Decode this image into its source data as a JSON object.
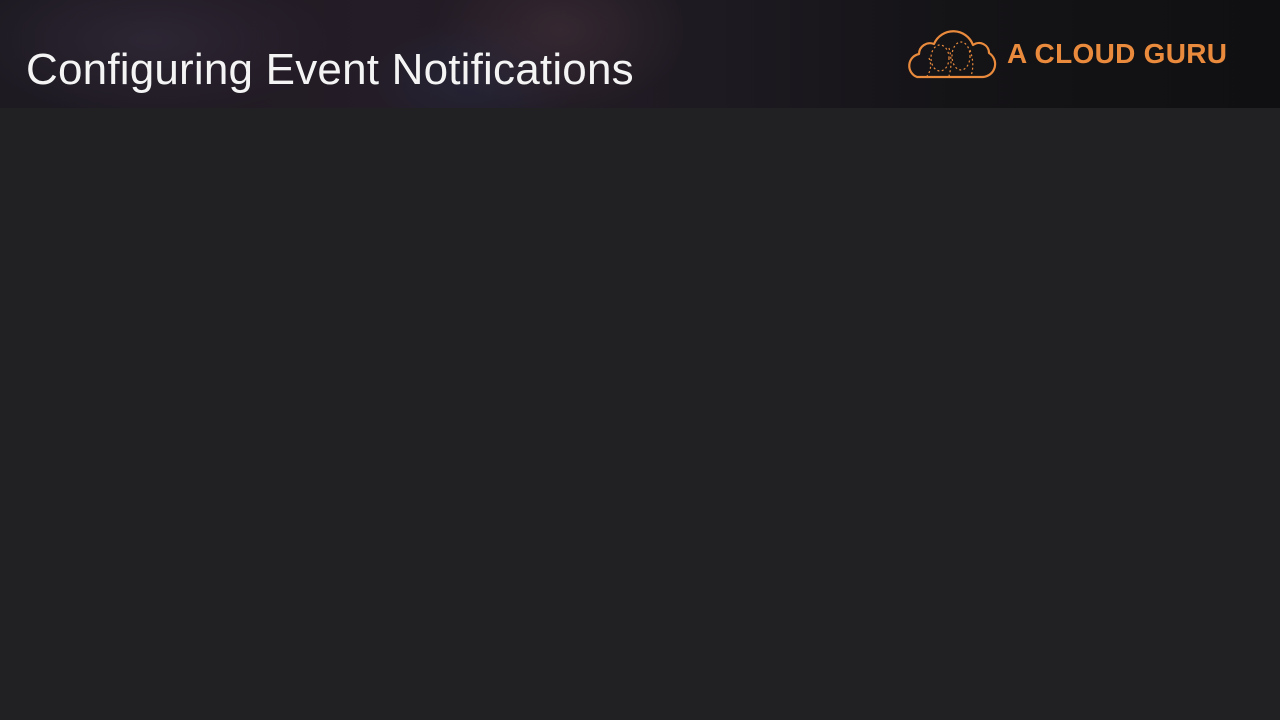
{
  "slide": {
    "title": "Configuring Event Notifications"
  },
  "logo": {
    "text": "A CLOUD GURU",
    "icon": "cloud-logo-icon",
    "color": "#e98a3c"
  },
  "colors": {
    "background": "#212123",
    "title": "#f4f4f4"
  }
}
